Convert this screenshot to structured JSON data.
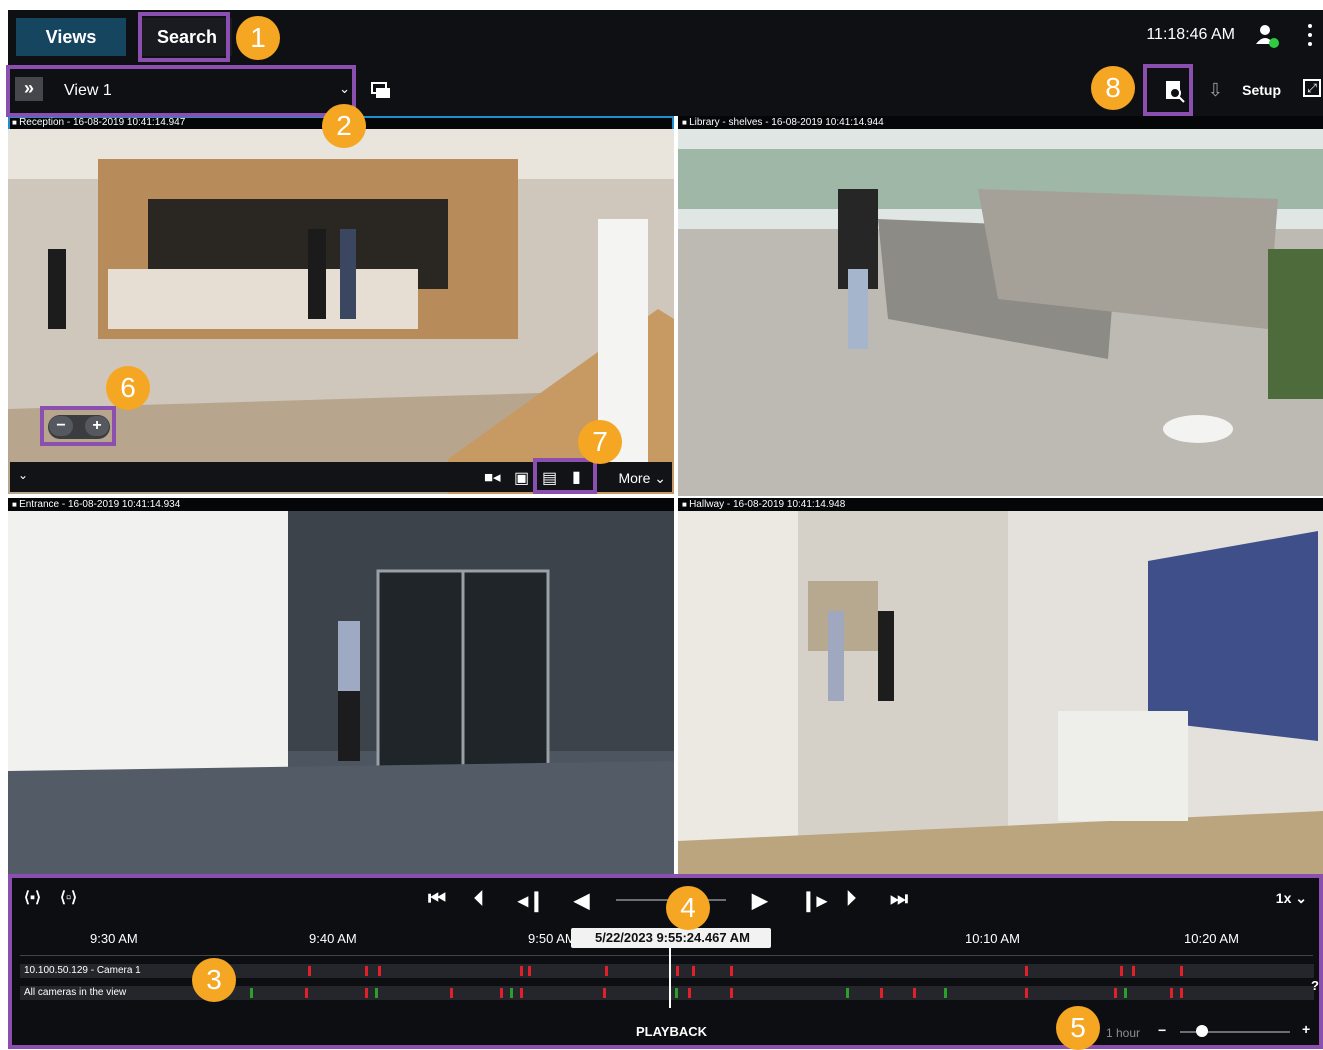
{
  "header": {
    "tabs": [
      {
        "label": "Views",
        "active": false
      },
      {
        "label": "Search",
        "active": true
      }
    ],
    "clock": "11:18:46 AM",
    "user_status_color": "#2ecc40"
  },
  "viewbar": {
    "view_name": "View 1",
    "setup_label": "Setup"
  },
  "cameras": [
    {
      "title": "Reception - 16-08-2019 10:41:14.947",
      "selected": true
    },
    {
      "title": "Library - shelves - 16-08-2019 10:41:14.944"
    },
    {
      "title": "Entrance - 16-08-2019 10:41:14.934"
    },
    {
      "title": "Hallway - 16-08-2019 10:41:14.948"
    }
  ],
  "tile_toolbar": {
    "more_label": "More",
    "icons": [
      "record-icon",
      "save-icon",
      "print-icon",
      "clipboard-icon"
    ]
  },
  "zoom": {
    "minus": "−",
    "plus": "+"
  },
  "timeline": {
    "ticks": [
      "9:30 AM",
      "9:40 AM",
      "9:50 AM",
      "10:10 AM",
      "10:20 AM"
    ],
    "tracks": [
      "10.100.50.129 - Camera 1",
      "All cameras in the view"
    ],
    "current_time": "5/22/2023 9:55:24.467 AM",
    "playback_label": "PLAYBACK",
    "speed": "1x",
    "time_span": "1 hour",
    "help": "?"
  },
  "callouts": [
    "1",
    "2",
    "3",
    "4",
    "5",
    "6",
    "7",
    "8"
  ],
  "colors": {
    "accent_purple": "#8b4fb0",
    "callout_orange": "#f5a623",
    "selection_blue": "#1b8fd0",
    "motion_red": "#e0202a",
    "motion_green": "#2aa02a"
  }
}
